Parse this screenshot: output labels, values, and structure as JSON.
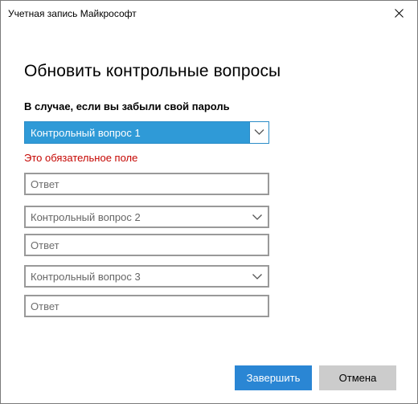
{
  "window": {
    "title": "Учетная запись Майкрософт",
    "close_icon": "close-icon"
  },
  "heading": "Обновить контрольные вопросы",
  "section_label": "В случае, если вы забыли свой пароль",
  "error_text": "Это обязательное поле",
  "questions": [
    {
      "label": "Контрольный вопрос 1",
      "active": true,
      "answer_placeholder": "Ответ"
    },
    {
      "label": "Контрольный вопрос 2",
      "active": false,
      "answer_placeholder": "Ответ"
    },
    {
      "label": "Контрольный вопрос 3",
      "active": false,
      "answer_placeholder": "Ответ"
    }
  ],
  "buttons": {
    "finish": "Завершить",
    "cancel": "Отмена"
  },
  "colors": {
    "accent": "#2f9ad7",
    "primary_button": "#2a86d4",
    "secondary_button": "#cccccc",
    "error": "#c50500"
  }
}
